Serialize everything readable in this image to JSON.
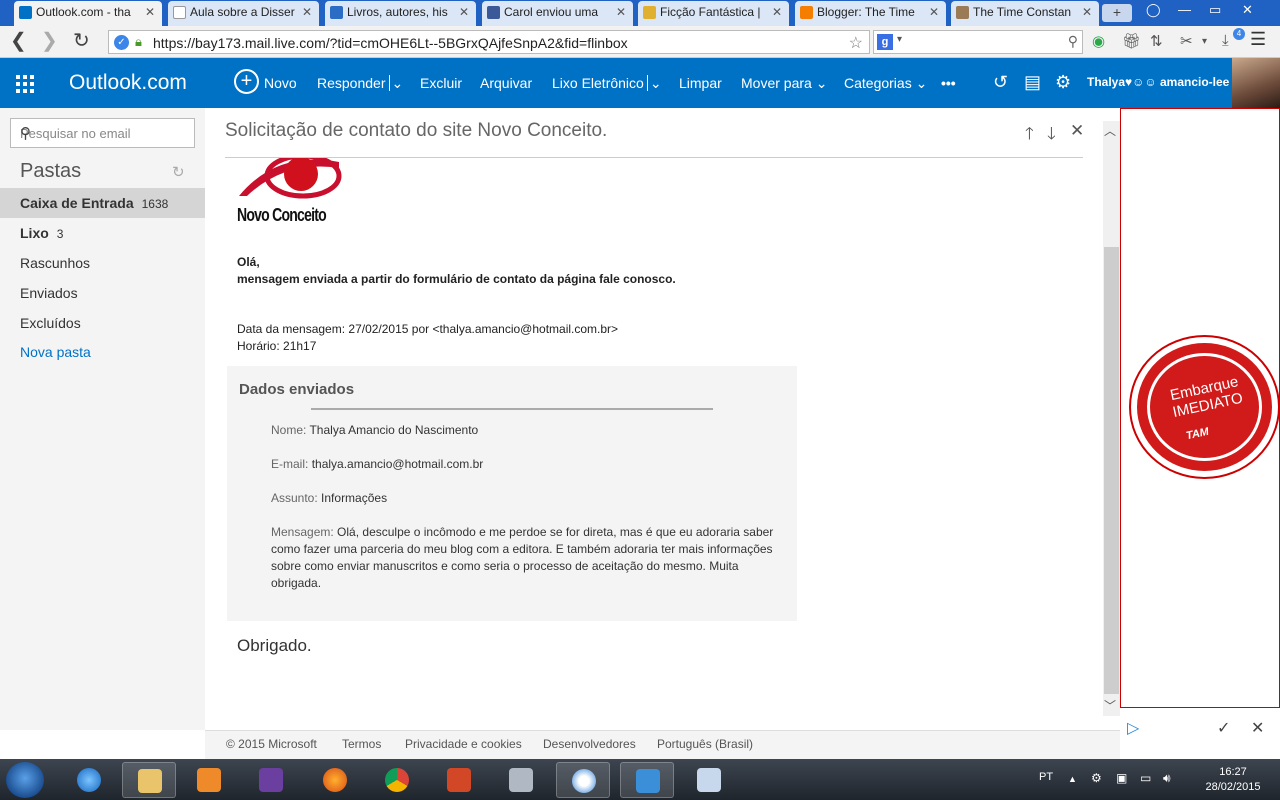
{
  "browser": {
    "tabs": [
      {
        "label": "Outlook.com - tha",
        "active": true,
        "favicon_color": "#0072c6"
      },
      {
        "label": "Aula sobre a Disser",
        "active": false,
        "favicon_color": "#ffffff"
      },
      {
        "label": "Livros, autores, his",
        "active": false,
        "favicon_color": "#2b6cc4"
      },
      {
        "label": "Carol enviou uma",
        "active": false,
        "favicon_color": "#3b5998"
      },
      {
        "label": "Ficção Fantástica |",
        "active": false,
        "favicon_color": "#e0b030"
      },
      {
        "label": "Blogger: The Time",
        "active": false,
        "favicon_color": "#f57d00"
      },
      {
        "label": "The Time Constan",
        "active": false,
        "favicon_color": "#9b7b55"
      }
    ],
    "new_tab": "+",
    "url": "https://bay173.mail.live.com/?tid=cmOHE6Lt--5BGrxQAjfeSnpA2&fid=flinbox",
    "search_engine_badge": "g",
    "extension_badge": "4"
  },
  "outlook": {
    "brand": "Outlook.com",
    "commands": {
      "new": "Novo",
      "reply": "Responder",
      "delete": "Excluir",
      "archive": "Arquivar",
      "junk": "Lixo Eletrônico",
      "sweep": "Limpar",
      "move": "Mover para",
      "categories": "Categorias",
      "more": "•••"
    },
    "user_name": "Thalya♥☺☺ amancio-lee"
  },
  "sidebar": {
    "search_placeholder": "Pesquisar no email",
    "folders_title": "Pastas",
    "folders": [
      {
        "label": "Caixa de Entrada",
        "count": "1638",
        "selected": true
      },
      {
        "label": "Lixo",
        "count": "3",
        "selected": false
      },
      {
        "label": "Rascunhos",
        "count": "",
        "selected": false
      },
      {
        "label": "Enviados",
        "count": "",
        "selected": false
      },
      {
        "label": "Excluídos",
        "count": "",
        "selected": false
      }
    ],
    "new_folder": "Nova pasta"
  },
  "message": {
    "subject": "Solicitação de contato do site Novo Conceito.",
    "logo_text": "Novo Conceito",
    "greeting": "Olá,",
    "intro": "mensagem enviada a partir do formulário de contato da página fale conosco.",
    "date_line": "Data da mensagem: 27/02/2015 por <thalya.amancio@hotmail.com.br>",
    "time_line": "Horário: 21h17",
    "data_title": "Dados enviados",
    "fields": {
      "name_label": "Nome:",
      "name_value": "Thalya Amancio do Nascimento",
      "email_label": "E-mail:",
      "email_value": "thalya.amancio@hotmail.com.br",
      "subject_label": "Assunto:",
      "subject_value": "Informações",
      "message_label": "Mensagem:",
      "message_value": "Olá, desculpe o incômodo e me perdoe se for direta, mas é que eu adoraria saber como fazer uma parceria do meu blog com a editora. E também adoraria ter mais informações sobre como enviar manuscritos e como seria o processo de aceitação do mesmo. Muita obrigada."
    },
    "closing": "Obrigado."
  },
  "ad": {
    "line1": "Embarque",
    "line2": "IMEDIATO",
    "brand": "TAM"
  },
  "footer": {
    "copyright": "© 2015 Microsoft",
    "terms": "Termos",
    "privacy": "Privacidade e cookies",
    "developers": "Desenvolvedores",
    "language": "Português (Brasil)"
  },
  "taskbar": {
    "language": "PT",
    "time": "16:27",
    "date": "28/02/2015"
  },
  "colors": {
    "outlook_blue": "#0072c6",
    "tab_strip": "#1f62c3",
    "ad_red": "#d11a1a",
    "link_blue": "#0072c6"
  }
}
